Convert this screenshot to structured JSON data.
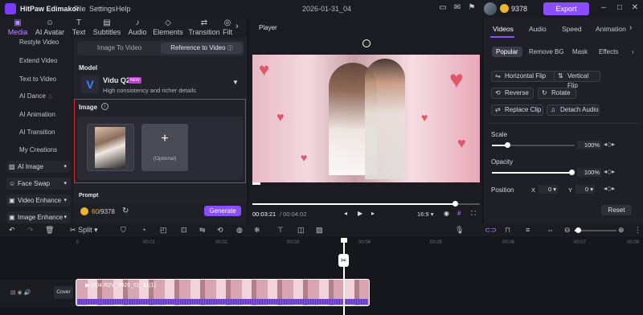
{
  "titlebar": {
    "app_name": "HitPaw Edimakor",
    "menus": [
      "File",
      "Settings",
      "Help"
    ],
    "project_title": "2026-01-31_04",
    "credits": "9378",
    "export_label": "Export"
  },
  "toolbar": {
    "items": [
      {
        "label": "Media",
        "icon": "media-icon"
      },
      {
        "label": "AI Avatar",
        "icon": "ai-avatar-icon"
      },
      {
        "label": "Text",
        "icon": "text-icon"
      },
      {
        "label": "Subtitles",
        "icon": "subtitles-icon"
      },
      {
        "label": "Audio",
        "icon": "audio-icon"
      },
      {
        "label": "Elements",
        "icon": "elements-icon"
      },
      {
        "label": "Transition",
        "icon": "transition-icon"
      },
      {
        "label": "Filt",
        "icon": "filter-icon"
      }
    ]
  },
  "sidebar": {
    "items": [
      "Restyle Video",
      "Extend Video",
      "Text to Video",
      "AI Dance",
      "AI Animation",
      "AI Transition",
      "My Creations"
    ],
    "groups": [
      "AI Image",
      "Face Swap",
      "Video Enhance",
      "Image Enhance"
    ]
  },
  "panel": {
    "tab_image_to_video": "Image To Video",
    "tab_reference_to_video": "Reference to Video",
    "model_label": "Model",
    "model_name": "Vidu Q2",
    "model_badge": "NEW",
    "model_desc": "High consistency and richer details",
    "image_label": "Image",
    "add_optional": "(Optional)",
    "prompt_label": "Prompt",
    "credits_used": "60",
    "credits_total": "/9378",
    "generate_label": "Generate"
  },
  "player": {
    "title": "Player",
    "time_current": "00:03:21",
    "time_total": "/ 00:04:02",
    "ratio": "16:9",
    "progress": 0.89
  },
  "properties": {
    "tabs": [
      "Videos",
      "Audio",
      "Speed",
      "Animation"
    ],
    "subtabs": [
      "Popular",
      "Remove BG",
      "Mask",
      "Effects"
    ],
    "actions": [
      "Horizontal Flip",
      "Vertical Flip",
      "Reverse",
      "Rotate",
      "Replace Clip",
      "Detach Audio"
    ],
    "scale_label": "Scale",
    "scale_value": "100%",
    "opacity_label": "Opacity",
    "opacity_value": "100%",
    "position_label": "Position",
    "pos_x_label": "X",
    "pos_x": "0",
    "pos_y_label": "Y",
    "pos_y": "0",
    "reset_label": "Reset"
  },
  "timeline": {
    "split_label": "Split",
    "ticks": [
      "0",
      "00:01",
      "00:02",
      "00:03",
      "00:04",
      "00:05",
      "00:06",
      "00:07",
      "00:08"
    ],
    "cover_label": "Cover",
    "clip_name": "0:04  R2V_2026_01_31(1)"
  },
  "colors": {
    "accent": "#8a4dff",
    "highlight": "#e0262f",
    "coin": "#f0b429"
  }
}
